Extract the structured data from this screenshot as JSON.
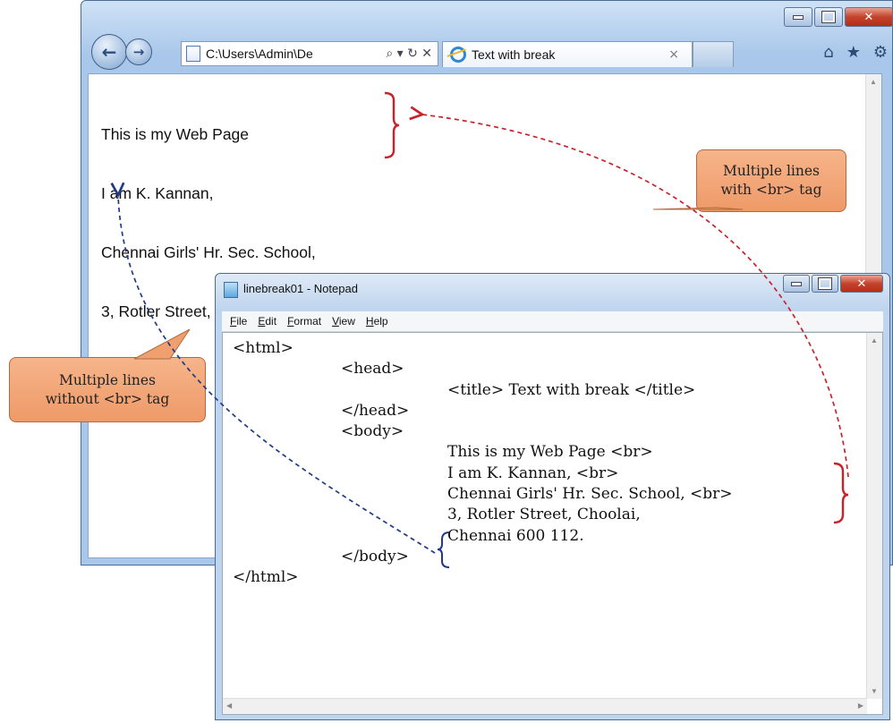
{
  "browser": {
    "address": "C:\\Users\\Admin\\De",
    "address_controls": "⌕ ▾ ↻ ✕",
    "tab_title": "Text with break",
    "tab_close": "×",
    "page_lines": [
      "This is my Web Page",
      "I am K. Kannan,",
      "Chennai Girls' Hr. Sec. School,",
      "3, Rotler Street, Choolai, Chennai 600 112."
    ]
  },
  "notepad": {
    "title": "linebreak01 - Notepad",
    "menu": [
      "File",
      "Edit",
      "Format",
      "View",
      "Help"
    ],
    "code": {
      "l1": "<html>",
      "l2": "<head>",
      "l3": "<title> Text with break </title>",
      "l4": "</head>",
      "l5": "<body>",
      "l6": "This is my Web Page <br>",
      "l7": "I am K. Kannan, <br>",
      "l8": "Chennai Girls' Hr. Sec. School, <br>",
      "l9": "3, Rotler Street, Choolai,",
      "l10": "Chennai 600 112.",
      "l11": "</body>",
      "l12": "</html>"
    }
  },
  "callouts": {
    "with_br": {
      "line1": "Multiple lines",
      "line2": "with <br> tag"
    },
    "without_br": {
      "line1": "Multiple lines",
      "line2": "without <br> tag"
    }
  },
  "colors": {
    "red_arrow": "#c8232c",
    "blue_arrow": "#1f3a8a",
    "callout_fill": "#f3a77a"
  }
}
